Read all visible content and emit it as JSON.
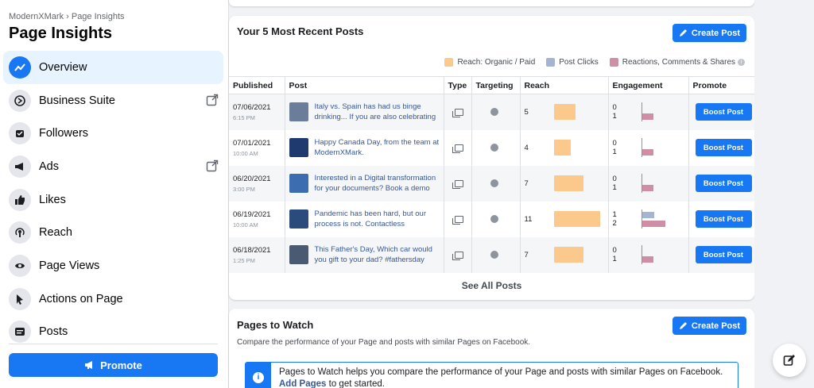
{
  "sidebar": {
    "breadcrumb": "ModernXMark › Page Insights",
    "title": "Page Insights",
    "items": [
      {
        "label": "Overview",
        "icon": "trend-icon",
        "active": true
      },
      {
        "label": "Business Suite",
        "icon": "business-suite-icon",
        "external": true
      },
      {
        "label": "Followers",
        "icon": "followers-icon"
      },
      {
        "label": "Ads",
        "icon": "megaphone-icon",
        "external": true
      },
      {
        "label": "Likes",
        "icon": "thumbs-up-icon"
      },
      {
        "label": "Reach",
        "icon": "broadcast-icon"
      },
      {
        "label": "Page Views",
        "icon": "eye-icon"
      },
      {
        "label": "Actions on Page",
        "icon": "cursor-icon"
      },
      {
        "label": "Posts",
        "icon": "posts-icon"
      }
    ],
    "promote_label": "Promote"
  },
  "recent_posts": {
    "title": "Your 5 Most Recent Posts",
    "create_label": "Create Post",
    "legend": [
      {
        "label": "Reach: Organic / Paid",
        "color": "#fcc98c"
      },
      {
        "label": "Post Clicks",
        "color": "#a5b4d2"
      },
      {
        "label": "Reactions, Comments & Shares",
        "color": "#cf8ea3"
      }
    ],
    "columns": [
      "Published",
      "Post",
      "Type",
      "Targeting",
      "Reach",
      "Engagement",
      "Promote"
    ],
    "rows": [
      {
        "date": "07/06/2021",
        "time": "6:15 PM",
        "post": "Italy vs. Spain has had us binge drinking... If you are also celebrating",
        "reach": 5,
        "clicks": 0,
        "reactions": 1,
        "thumb_color": "#6b7d99"
      },
      {
        "date": "07/01/2021",
        "time": "10:00 AM",
        "post": "Happy Canada Day, from the team at ModernXMark.",
        "reach": 4,
        "clicks": 0,
        "reactions": 1,
        "thumb_color": "#1f3a6e"
      },
      {
        "date": "06/20/2021",
        "time": "3:00 PM",
        "post": "Interested in a Digital transformation for your documents? Book a demo",
        "reach": 7,
        "clicks": 0,
        "reactions": 1,
        "thumb_color": "#3b6db0"
      },
      {
        "date": "06/19/2021",
        "time": "10:00 AM",
        "post": "Pandemic has been hard, but our process is not. Contactless",
        "reach": 11,
        "clicks": 1,
        "reactions": 2,
        "thumb_color": "#2a4b7c"
      },
      {
        "date": "06/18/2021",
        "time": "1:25 PM",
        "post": "This Father's Day, Which car would you gift to your dad? #fathersday",
        "reach": 7,
        "clicks": 0,
        "reactions": 1,
        "thumb_color": "#4a5a72"
      }
    ],
    "boost_label": "Boost Post",
    "see_all_label": "See All Posts"
  },
  "pages_to_watch": {
    "title": "Pages to Watch",
    "create_label": "Create Post",
    "description": "Compare the performance of your Page and posts with similar Pages on Facebook.",
    "info_text": "Pages to Watch helps you compare the performance of your Page and posts with similar Pages on Facebook.",
    "info_link": "Add Pages",
    "info_suffix": " to get started."
  }
}
